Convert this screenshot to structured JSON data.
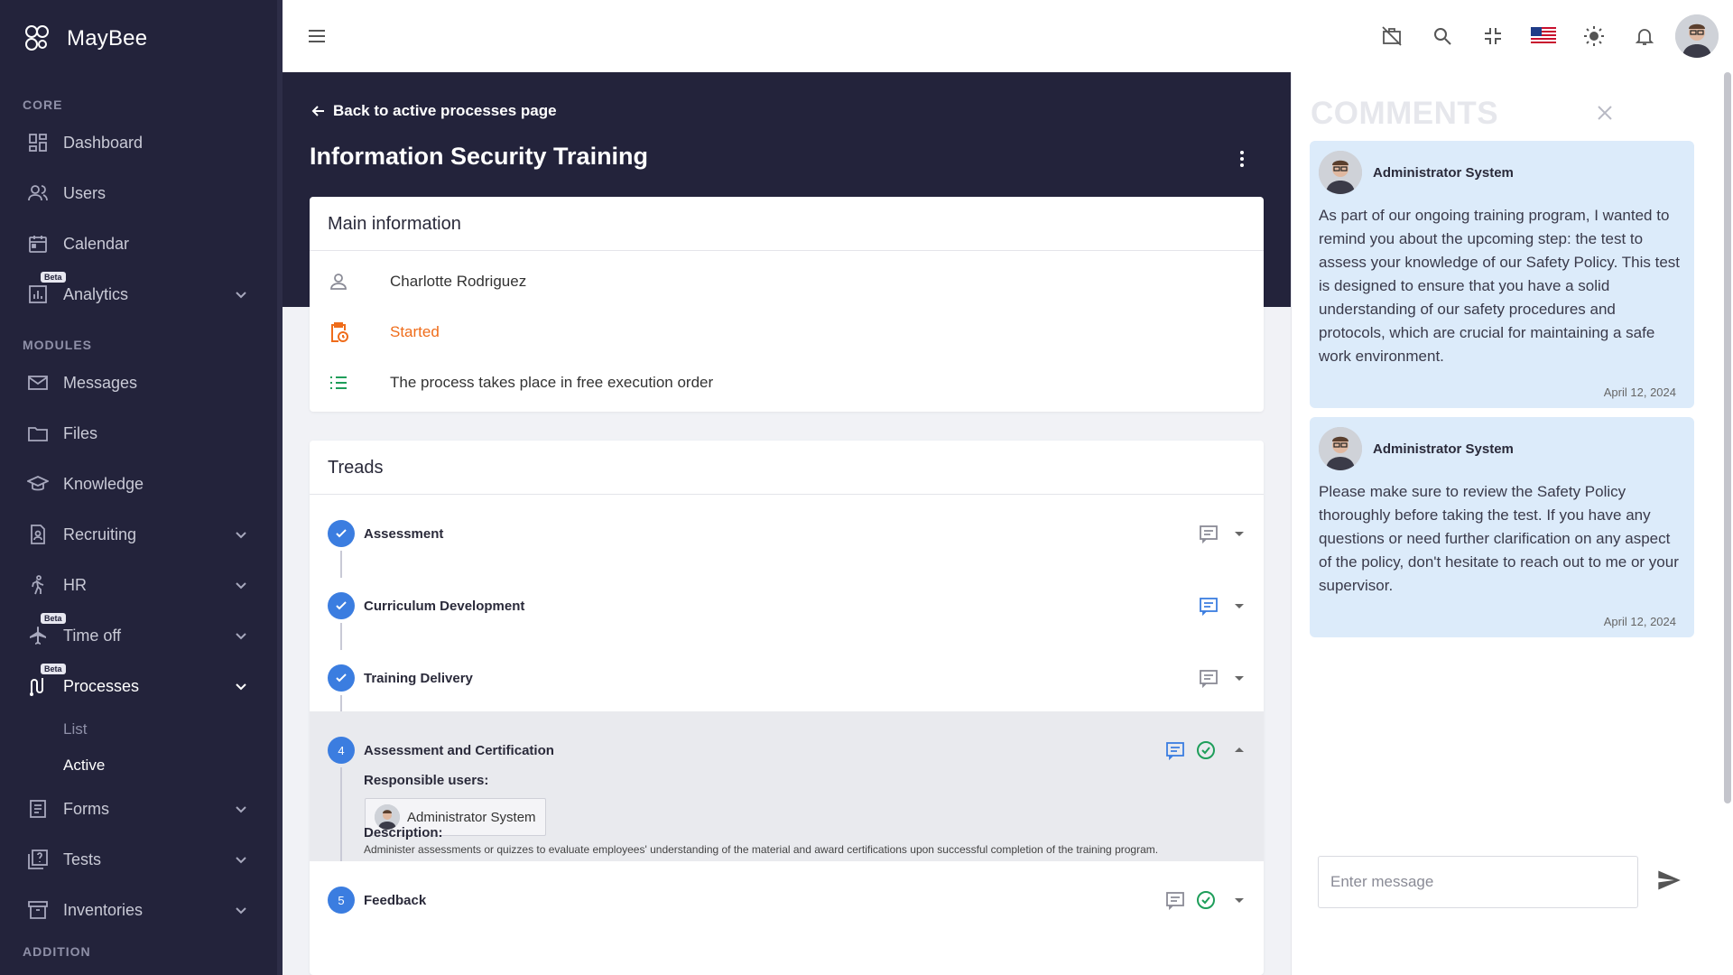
{
  "brand": {
    "name": "MayBee"
  },
  "sidebar": {
    "sections": {
      "core": "CORE",
      "modules": "MODULES",
      "addition": "ADDITION"
    },
    "core_items": [
      {
        "label": "Dashboard",
        "icon": "dashboard-icon"
      },
      {
        "label": "Users",
        "icon": "users-icon"
      },
      {
        "label": "Calendar",
        "icon": "calendar-icon"
      },
      {
        "label": "Analytics",
        "icon": "analytics-icon",
        "badge": "Beta"
      }
    ],
    "module_items": [
      {
        "label": "Messages",
        "icon": "mail-icon"
      },
      {
        "label": "Files",
        "icon": "folder-icon"
      },
      {
        "label": "Knowledge",
        "icon": "graduation-cap-icon"
      },
      {
        "label": "Recruiting",
        "icon": "document-person-icon"
      },
      {
        "label": "HR",
        "icon": "person-walking-icon"
      },
      {
        "label": "Time off",
        "icon": "airplane-icon",
        "badge": "Beta"
      },
      {
        "label": "Processes",
        "icon": "process-icon",
        "badge": "Beta"
      },
      {
        "label": "Forms",
        "icon": "form-icon"
      },
      {
        "label": "Tests",
        "icon": "quiz-icon"
      },
      {
        "label": "Inventories",
        "icon": "inventory-icon"
      }
    ],
    "processes_sub": [
      {
        "label": "List"
      },
      {
        "label": "Active"
      }
    ]
  },
  "header": {
    "back_link": "Back to active processes page",
    "title": "Information Security Training"
  },
  "main_info": {
    "title": "Main information",
    "user": "Charlotte Rodriguez",
    "status": "Started",
    "order": "The process takes place in free execution order"
  },
  "treads": {
    "title": "Treads",
    "items": [
      {
        "step": "1",
        "title": "Assessment",
        "done": true
      },
      {
        "step": "2",
        "title": "Curriculum Development",
        "done": true
      },
      {
        "step": "3",
        "title": "Training Delivery",
        "done": true
      },
      {
        "step": "4",
        "title": "Assessment and Certification",
        "done": false
      },
      {
        "step": "5",
        "title": "Feedback",
        "done": false
      }
    ],
    "expanded": {
      "responsible_label": "Responsible users:",
      "responsible_user": "Administrator System",
      "description_label": "Description:",
      "description": "Administer assessments or quizzes to evaluate employees' understanding of the material and award certifications upon successful completion of the training program."
    }
  },
  "comments": {
    "title": "COMMENTS",
    "items": [
      {
        "author": "Administrator System",
        "text": "As part of our ongoing training program, I wanted to remind you about the upcoming step: the test to assess your knowledge of our Safety Policy. This test is designed to ensure that you have a solid understanding of our safety procedures and protocols, which are crucial for maintaining a safe work environment.",
        "date": "April 12, 2024"
      },
      {
        "author": "Administrator System",
        "text": "Please make sure to review the Safety Policy thoroughly before taking the test. If you have any questions or need further clarification on any aspect of the policy, don't hesitate to reach out to me or your supervisor.",
        "date": "April 12, 2024"
      }
    ],
    "input_placeholder": "Enter message"
  },
  "colors": {
    "sidebar_bg": "#23233b",
    "accent_blue": "#3b7de0",
    "status_orange": "#ef6c1a",
    "success_green": "#1e9e5a",
    "comment_bg": "#dcebfa"
  }
}
